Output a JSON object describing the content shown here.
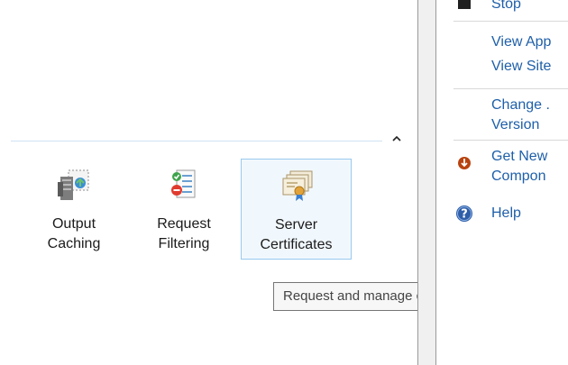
{
  "features": [
    {
      "label_line1": "Output",
      "label_line2": "Caching",
      "icon": "output-caching-icon"
    },
    {
      "label_line1": "Request",
      "label_line2": "Filtering",
      "icon": "request-filtering-icon"
    },
    {
      "label_line1": "Server",
      "label_line2": "Certificates",
      "icon": "server-certificates-icon",
      "selected": true
    }
  ],
  "tooltip": {
    "text": "Request and manage certificates fo"
  },
  "actions": {
    "stop": "Stop",
    "view_app": "View App",
    "view_site": "View Site",
    "change_line1": "Change .",
    "change_line2": "Version",
    "get_new_line1": "Get New",
    "get_new_line2": "Compon",
    "help": "Help"
  },
  "colors": {
    "link": "#1e5fa9",
    "selection_border": "#99c9ef"
  }
}
